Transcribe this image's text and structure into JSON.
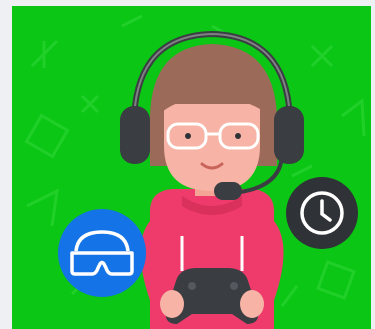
{
  "illustration": {
    "subject": "gamer-with-headset",
    "background_color": "#0bc614",
    "pattern_color": "#24d12c",
    "hair_color": "#9b6a58",
    "skin_color": "#f7b3a5",
    "shirt_color": "#ef3b6b",
    "headset_color": "#3a3d42",
    "controller_color": "#3a3d42"
  },
  "badges": {
    "vr_badge": {
      "icon": "vr-headset-icon",
      "color": "#1473e6"
    },
    "clock_badge": {
      "icon": "clock-icon",
      "color": "#2f3236"
    }
  }
}
